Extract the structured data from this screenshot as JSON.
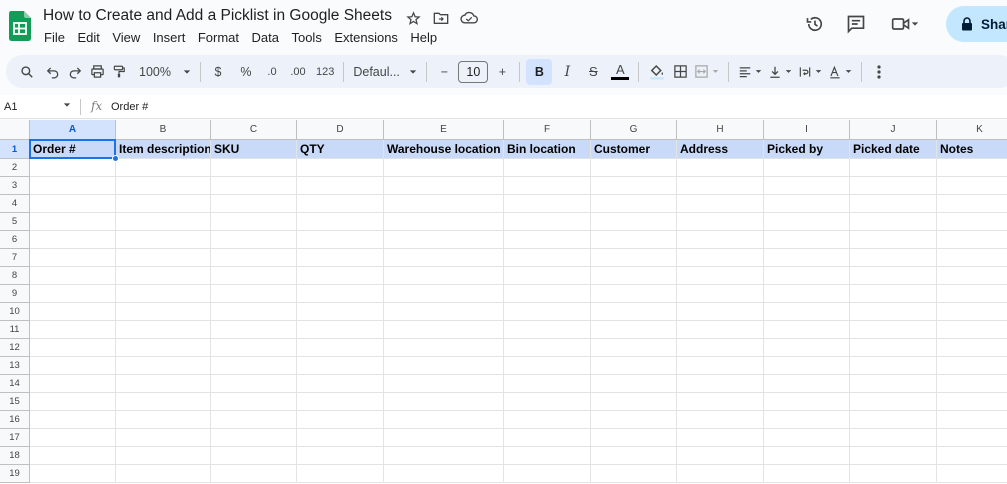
{
  "doc": {
    "title": "How to Create and Add a Picklist in Google Sheets"
  },
  "menu": [
    "File",
    "Edit",
    "View",
    "Insert",
    "Format",
    "Data",
    "Tools",
    "Extensions",
    "Help"
  ],
  "share": {
    "label": "Share"
  },
  "toolbar": {
    "zoom": "100%",
    "currency": "$",
    "percent": "%",
    "dec_decrease": ".0",
    "dec_increase": ".00",
    "number_format": "123",
    "font": "Defaul...",
    "font_size": "10",
    "bold": "B",
    "italic": "I",
    "strike": "S",
    "text_color": "A",
    "minus": "−",
    "plus": "+"
  },
  "formula_bar": {
    "cell_ref": "A1",
    "fx": "fx",
    "value": "Order #"
  },
  "columns": [
    "A",
    "B",
    "C",
    "D",
    "E",
    "F",
    "G",
    "H",
    "I",
    "J",
    "K"
  ],
  "rows": [
    "1",
    "2",
    "3",
    "4",
    "5",
    "6",
    "7",
    "8",
    "9",
    "10",
    "11",
    "12",
    "13",
    "14",
    "15",
    "16",
    "17",
    "18",
    "19"
  ],
  "header_row": [
    "Order #",
    "Item description",
    "SKU",
    "QTY",
    "Warehouse location",
    "Bin location",
    "Customer",
    "Address",
    "Picked by",
    "Picked date",
    "Notes"
  ],
  "colors": {
    "header_fill": "#c9daf8",
    "selection": "#1a73e8",
    "share_button": "#c2e7ff",
    "toolbar_bg": "#edf2fa"
  }
}
